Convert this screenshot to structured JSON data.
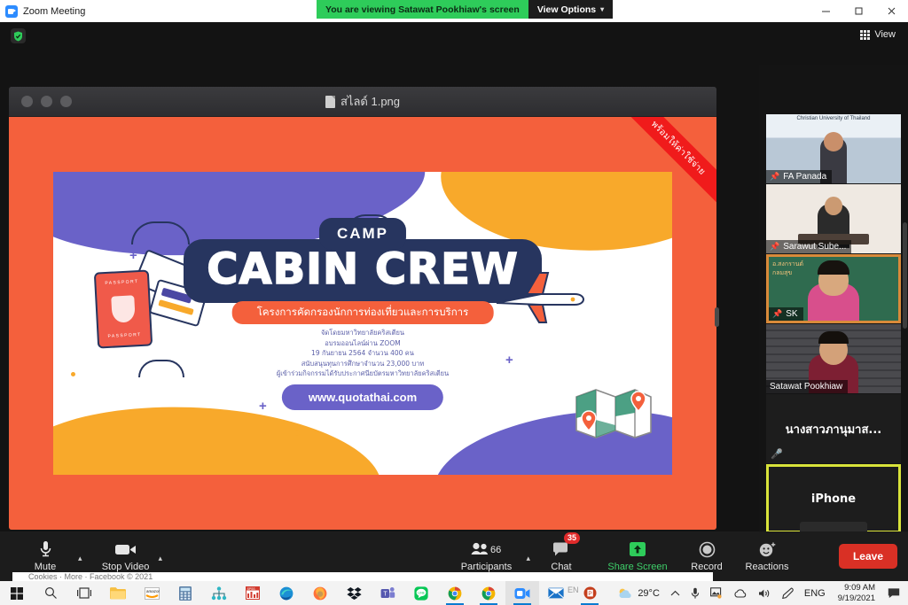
{
  "titlebar": {
    "app_title": "Zoom Meeting",
    "app_icon": "zoom-logo-icon",
    "viewing_banner": "You are viewing Satawat Pookhiaw's screen",
    "view_options": "View Options",
    "minimize": "─",
    "maximize": "❐",
    "close": "✕"
  },
  "meeting": {
    "encryption_icon": "shield-check-icon",
    "view_button": "View"
  },
  "shared_window": {
    "file_title": "สไลด์ 1.png",
    "file_icon": "image-file-icon"
  },
  "poster": {
    "ribbon_text": "พร้อมให้ค่าใช้จ่าย",
    "camp": "CAMP",
    "title": "CABIN CREW",
    "subtitle": "โครงการคัดกรองนักการท่องเที่ยวและการบริการ",
    "fineprint": [
      "จัดโดยมหาวิทยาลัยคริสเตียน",
      "อบรมออนไลน์ผ่าน ZOOM",
      "19 กันยายน 2564 จำนวน 400 คน",
      "สนับสนุนทุนการศึกษาจำนวน 23,000 บาท",
      "ผู้เข้าร่วมกิจกรรมได้รับประกาศนียบัตรมหาวิทยาลัยคริสเตียน"
    ],
    "url": "www.quotathai.com",
    "passport_label": "PASSPORT",
    "colors": {
      "orange_bg": "#f4603c",
      "navy": "#27355f",
      "purple": "#6a62c8",
      "yellow": "#f8a92b",
      "ribbon_red": "#f01b1b"
    }
  },
  "filmstrip": {
    "participants": [
      {
        "name": "FA  Panada",
        "pinned": true,
        "muted": false,
        "active": false,
        "avatar": false
      },
      {
        "name": "Sarawut Sube...",
        "pinned": true,
        "muted": false,
        "active": false,
        "avatar": false
      },
      {
        "name": "SK",
        "pinned": true,
        "muted": false,
        "active": false,
        "avatar": false
      },
      {
        "name": "Satawat Pookhiaw",
        "pinned": false,
        "muted": false,
        "active": false,
        "avatar": false
      },
      {
        "name": "นางสาวภานุมาส...",
        "pinned": false,
        "muted": true,
        "active": false,
        "avatar": true
      },
      {
        "name": "iPhone",
        "pinned": false,
        "muted": false,
        "active": true,
        "avatar": true
      }
    ],
    "pin_icon": "pin-icon",
    "mic_off_icon": "mic-muted-icon",
    "scroll_down_icon": "chevron-down-icon"
  },
  "toolbar": {
    "mute": {
      "label": "Mute",
      "icon": "microphone-icon"
    },
    "video": {
      "label": "Stop Video",
      "icon": "video-camera-icon"
    },
    "participants": {
      "label": "Participants",
      "count": "66",
      "icon": "people-icon"
    },
    "chat": {
      "label": "Chat",
      "badge": "35",
      "icon": "chat-bubble-icon"
    },
    "share": {
      "label": "Share Screen",
      "icon": "share-arrow-up-icon"
    },
    "record": {
      "label": "Record",
      "icon": "record-circle-icon"
    },
    "reactions": {
      "label": "Reactions",
      "icon": "smiley-plus-icon"
    },
    "leave": {
      "label": "Leave"
    }
  },
  "taskbar": {
    "icons": [
      "windows-start-icon",
      "search-icon",
      "task-view-icon",
      "file-explorer-icon",
      "amazon-icon",
      "calculator-icon",
      "node-tree-icon",
      "spss-icon",
      "edge-icon",
      "firefox-icon",
      "dropbox-icon",
      "teams-icon",
      "line-icon",
      "chrome-icon",
      "chrome-window-icon",
      "zoom-icon",
      "mail-icon",
      "powerpoint-icon"
    ],
    "ime_indicator": "EN",
    "weather": {
      "temp": "29°C",
      "icon": "partly-cloudy-icon"
    },
    "tray": [
      "chevron-up-icon",
      "microphone-icon",
      "photos-icon",
      "onedrive-icon",
      "volume-icon",
      "pen-icon"
    ],
    "language": "ENG",
    "time": "9:09 AM",
    "date": "9/19/2021",
    "notification_icon": "notification-icon"
  },
  "background_page": {
    "bleed_text": "Cookies · More · Facebook © 2021"
  }
}
